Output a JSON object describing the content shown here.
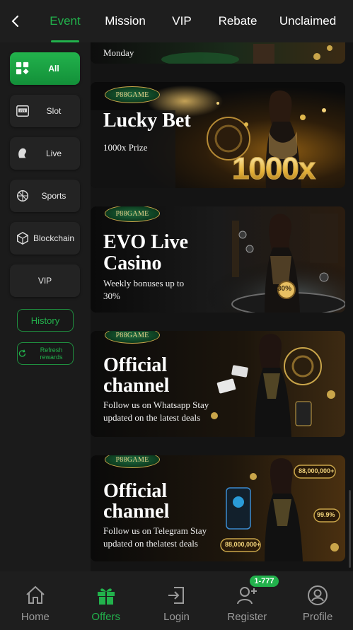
{
  "header": {
    "tabs": [
      {
        "label": "Event",
        "active": true
      },
      {
        "label": "Mission"
      },
      {
        "label": "VIP"
      },
      {
        "label": "Rebate"
      },
      {
        "label": "Unclaimed"
      }
    ]
  },
  "sidebar": {
    "categories": [
      {
        "label": "All",
        "icon": "all-grid-icon",
        "active": true
      },
      {
        "label": "Slot",
        "icon": "slot-machine-icon"
      },
      {
        "label": "Live",
        "icon": "live-dealer-icon"
      },
      {
        "label": "Sports",
        "icon": "sports-ball-icon"
      },
      {
        "label": "Blockchain",
        "icon": "blockchain-cube-icon"
      },
      {
        "label": "VIP"
      }
    ],
    "history_label": "History",
    "refresh_label": "Refresh rewards"
  },
  "banners": [
    {
      "partial_text": "Monday"
    },
    {
      "brand": "P88GAME",
      "title": "Lucky Bet",
      "subtitle": "1000x Prize",
      "badge": "1000x"
    },
    {
      "brand": "P88GAME",
      "title_line1": "EVO Live",
      "title_line2": "Casino",
      "subtitle_line1": "Weekly bonuses up to",
      "subtitle_line2": "30%",
      "chip": "30%"
    },
    {
      "brand": "P88GAME",
      "title_line1": "Official",
      "title_line2": "channel",
      "subtitle_line1": "Follow us on Whatsapp Stay",
      "subtitle_line2": "updated on the latest deals"
    },
    {
      "brand": "P88GAME",
      "title_line1": "Official",
      "title_line2": "channel",
      "subtitle_line1": "Follow us on Telegram Stay",
      "subtitle_line2": "updated on thelatest deals",
      "chip1": "88,000,000+",
      "chip2": "99.9%",
      "chip3": "88,000,000+"
    }
  ],
  "bottom_nav": [
    {
      "label": "Home",
      "icon": "home-icon"
    },
    {
      "label": "Offers",
      "icon": "gift-icon",
      "active": true
    },
    {
      "label": "Login",
      "icon": "login-icon"
    },
    {
      "label": "Register",
      "icon": "add-user-icon",
      "badge": "1-777"
    },
    {
      "label": "Profile",
      "icon": "profile-icon"
    }
  ],
  "colors": {
    "accent": "#22b24c",
    "background": "#141414",
    "panel": "#1e1e1e",
    "gold": "#c9a54a"
  }
}
